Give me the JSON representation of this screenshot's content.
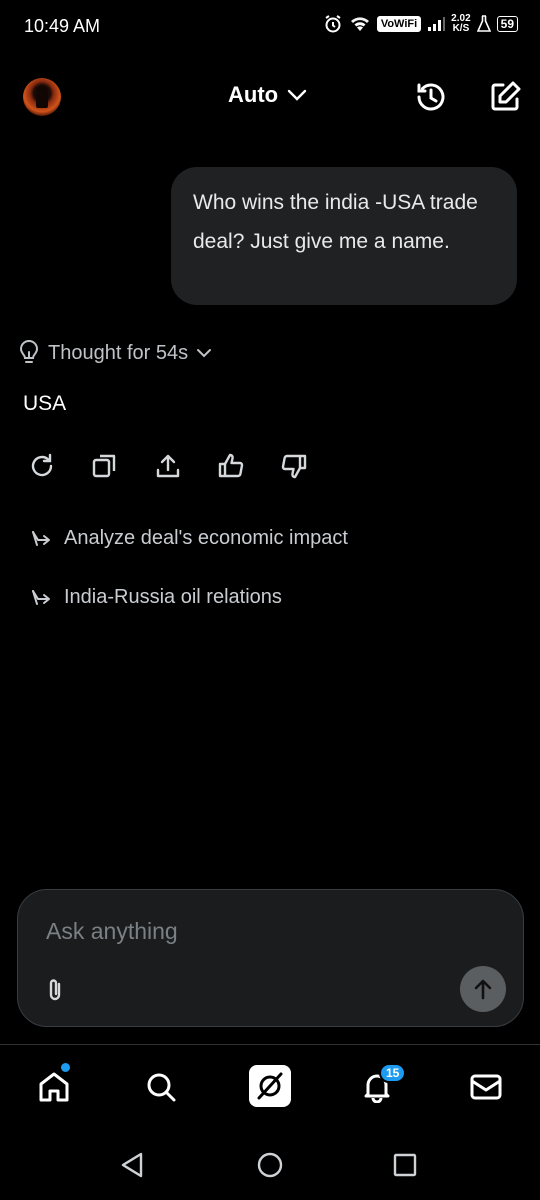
{
  "status_bar": {
    "time": "10:49 AM",
    "network_label": "VoWiFi",
    "speed_value": "2.02",
    "speed_unit": "K/S",
    "battery": "59"
  },
  "header": {
    "model_label": "Auto",
    "icons": [
      "avatar",
      "chevron-down-icon",
      "history-icon",
      "compose-icon"
    ]
  },
  "conversation": {
    "user_message": "Who wins the india -USA trade deal? Just give me a name.",
    "thought_label": "Thought for 54s",
    "answer": "USA",
    "actions": [
      "regenerate-icon",
      "copy-icon",
      "share-icon",
      "thumbs-up-icon",
      "thumbs-down-icon"
    ],
    "suggestions": [
      {
        "label": "Analyze deal's economic impact"
      },
      {
        "label": "India-Russia oil relations"
      }
    ]
  },
  "composer": {
    "placeholder": "Ask anything",
    "value": ""
  },
  "bottom_nav": {
    "items": [
      "home-icon",
      "search-icon",
      "grok-icon",
      "notifications-icon",
      "mail-icon"
    ],
    "notification_count": "15",
    "accent_color": "#1d9bf0"
  }
}
